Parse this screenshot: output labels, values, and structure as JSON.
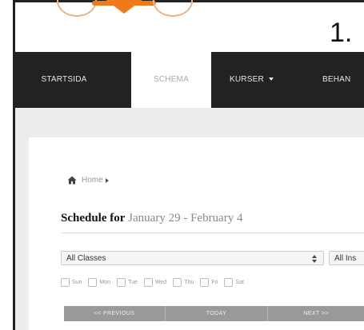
{
  "page": {
    "heading_number": "1."
  },
  "nav": {
    "items": [
      {
        "label": "STARTSIDA"
      },
      {
        "label": "SCHEMA"
      },
      {
        "label": "KURSER"
      },
      {
        "label": "BEHAN"
      }
    ],
    "active_index": 1
  },
  "breadcrumb": {
    "home_label": "Home"
  },
  "schedule": {
    "title_strong": "Schedule for",
    "title_range": "January 29 - February 4"
  },
  "filters": {
    "class_select_value": "All Classes",
    "instructor_select_value": "All Ins",
    "days": [
      "Sun",
      "Mon",
      "Tue",
      "Wed",
      "Thu",
      "Fri",
      "Sat"
    ]
  },
  "pager": {
    "prev_label": "<< PREVIOUS",
    "today_label": "TODAY",
    "next_label": "NEXT >>"
  },
  "colors": {
    "nav_bg": "#222222",
    "band_bg": "#ededed",
    "logo_orange": "#f07a1a"
  },
  "icons": [
    "home-icon",
    "caret-down-icon",
    "chevron-right-icon",
    "select-arrows-icon"
  ]
}
